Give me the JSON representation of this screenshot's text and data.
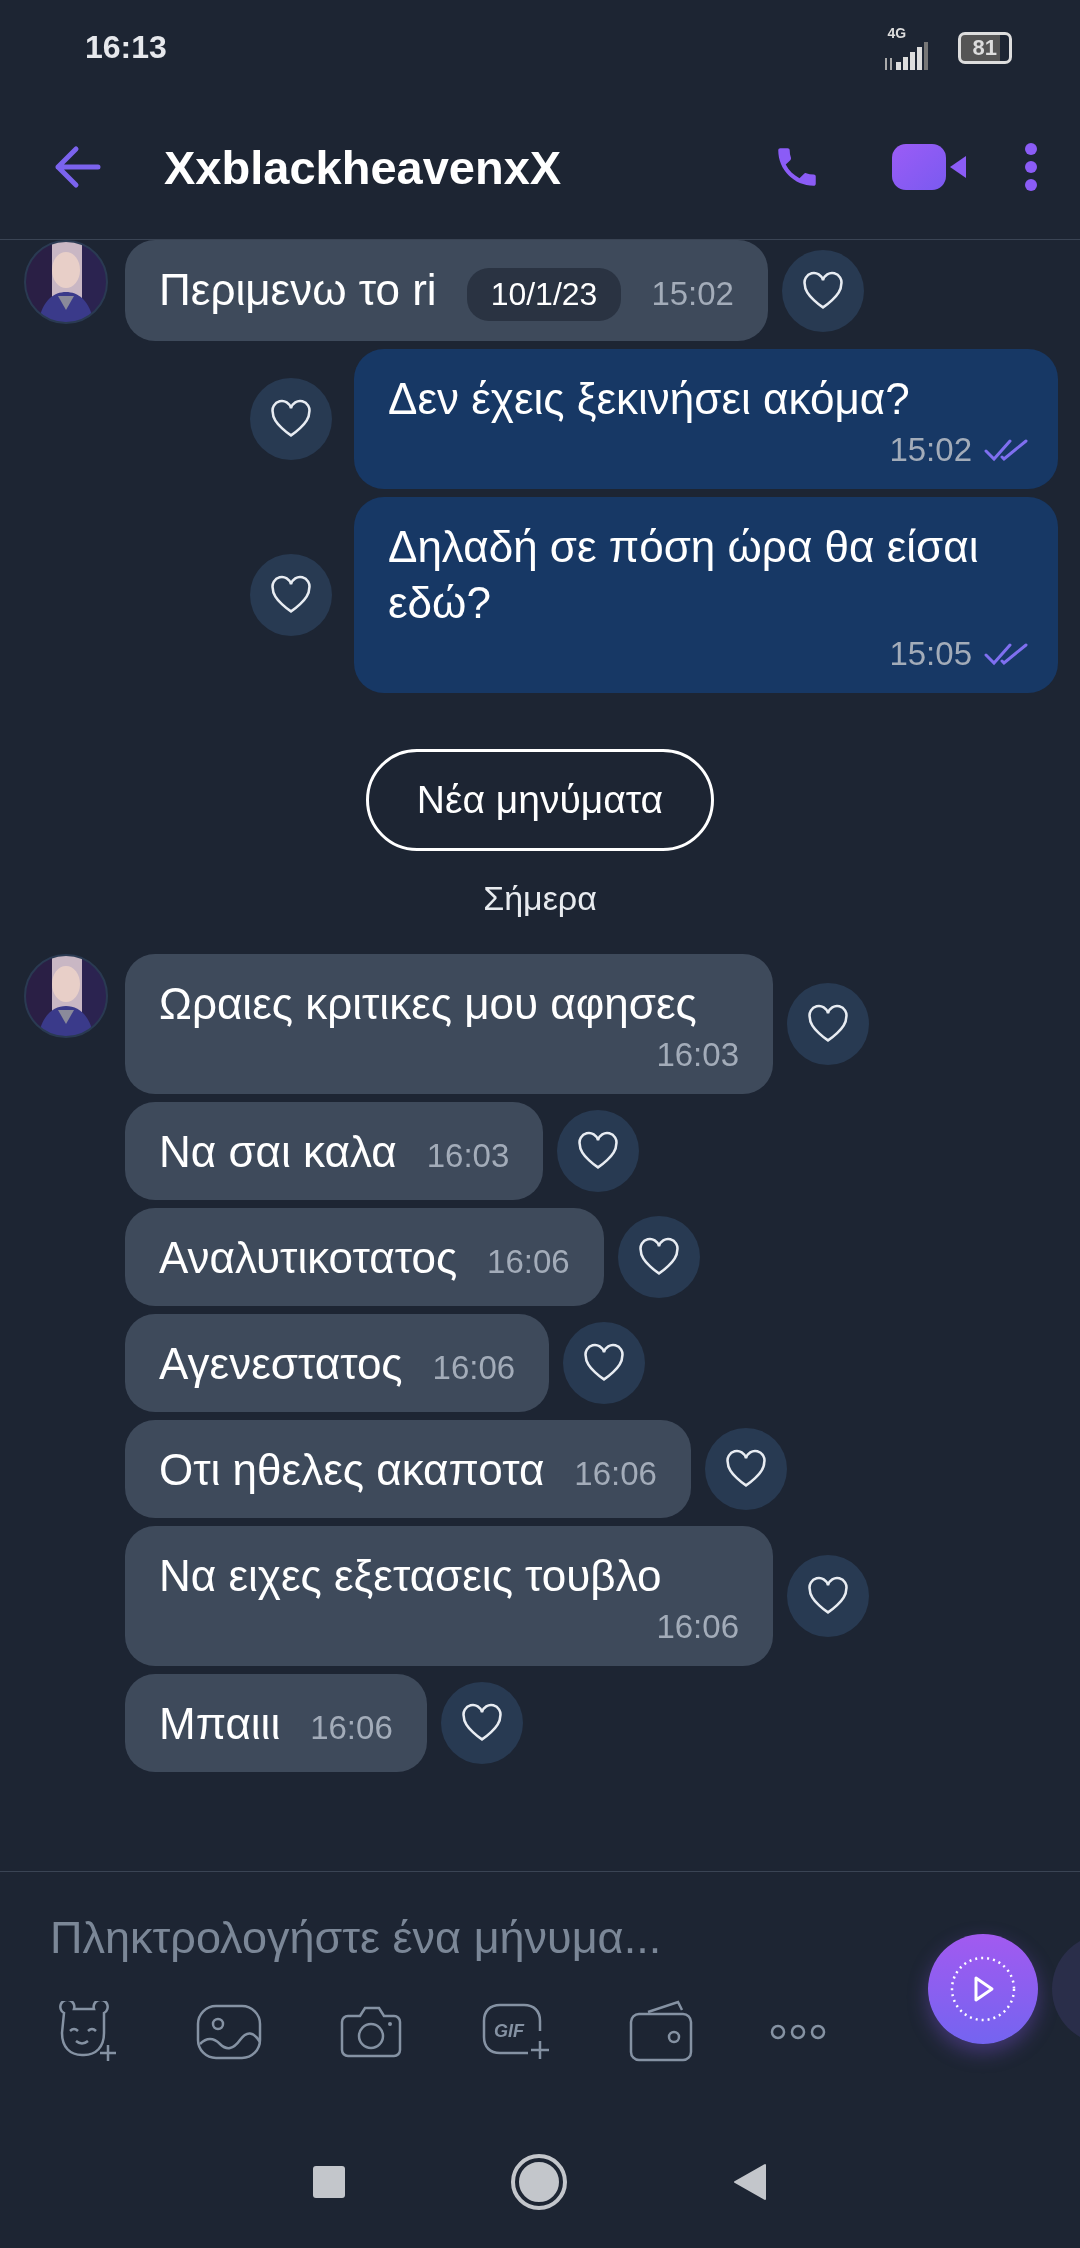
{
  "status_bar": {
    "time": "16:13",
    "network": "4G",
    "battery": "81"
  },
  "header": {
    "title": "XxblackheavenxX"
  },
  "items": [
    {
      "kind": "incoming",
      "avatar": true,
      "text": "Περιμενω το ri",
      "date_chip": "10/1/23",
      "time": "15:02"
    },
    {
      "kind": "outgoing",
      "text": "Δεν έχεις ξεκινήσει ακόμα?",
      "time": "15:02",
      "read": true
    },
    {
      "kind": "outgoing",
      "text": "Δηλαδή σε πόση ώρα θα είσαι εδώ?",
      "time": "15:05",
      "read": true
    },
    {
      "kind": "new_button",
      "text": "Νέα μηνύματα"
    },
    {
      "kind": "day",
      "text": "Σήμερα"
    },
    {
      "kind": "incoming",
      "avatar": true,
      "text": "Ωραιες κριτικες μου αφησες",
      "time": "16:03"
    },
    {
      "kind": "incoming",
      "avatar": false,
      "text": "Να σαι καλα",
      "time": "16:03"
    },
    {
      "kind": "incoming",
      "avatar": false,
      "text": "Αναλυτικοτατος",
      "time": "16:06"
    },
    {
      "kind": "incoming",
      "avatar": false,
      "text": "Αγενεστατος",
      "time": "16:06"
    },
    {
      "kind": "incoming",
      "avatar": false,
      "text": "Οτι ηθελες ακαποτα",
      "time": "16:06"
    },
    {
      "kind": "incoming",
      "avatar": false,
      "text": "Να ειχες εξετασεις τουβλο",
      "time": "16:06"
    },
    {
      "kind": "incoming",
      "avatar": false,
      "text": "Μπαιιι",
      "time": "16:06"
    }
  ],
  "composer": {
    "placeholder": "Πληκτρολογήστε ένα μήνυμα...",
    "gif_label": "GIF"
  }
}
